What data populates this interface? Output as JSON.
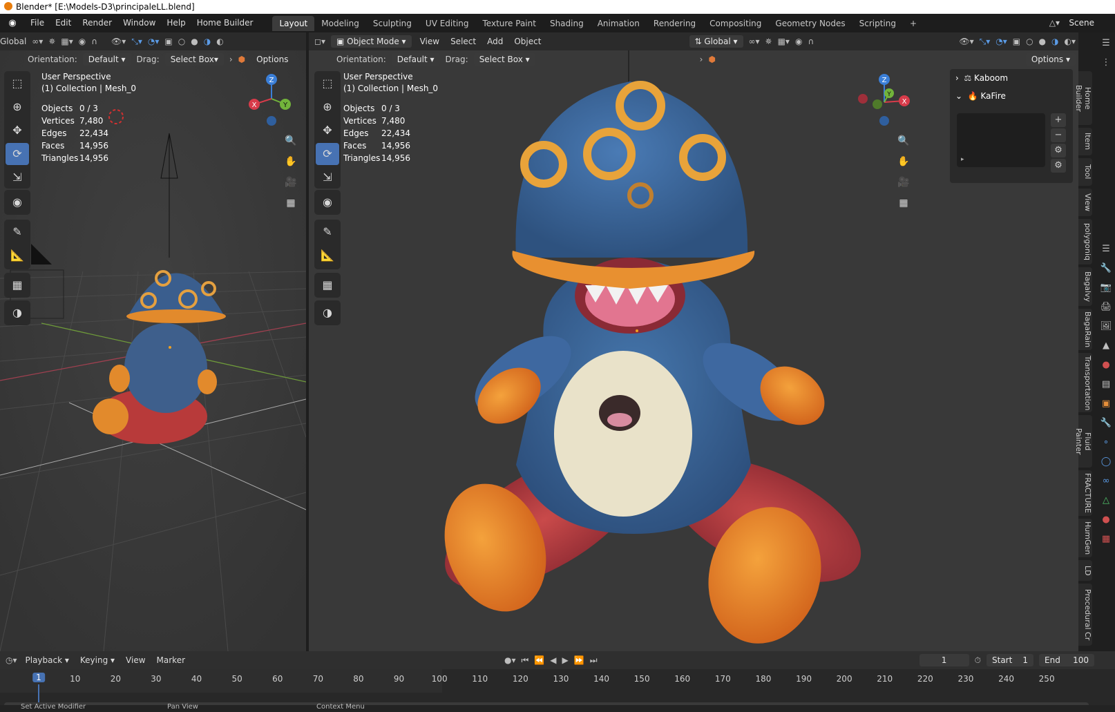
{
  "window": {
    "title": "Blender* [E:\\Models-D3\\principaleLL.blend]"
  },
  "menu": {
    "items": [
      "File",
      "Edit",
      "Render",
      "Window",
      "Help",
      "Home Builder"
    ]
  },
  "workspaces": [
    "Layout",
    "Modeling",
    "Sculpting",
    "UV Editing",
    "Texture Paint",
    "Shading",
    "Animation",
    "Rendering",
    "Compositing",
    "Geometry Nodes",
    "Scripting"
  ],
  "active_workspace": "Layout",
  "scene": {
    "label": "Scene"
  },
  "left_view": {
    "orientation_dd": "Global",
    "orientation_label": "Orientation:",
    "orientation_value": "Default",
    "drag_label": "Drag:",
    "drag_value": "Select Box",
    "options": "Options",
    "title": "User Perspective",
    "subtitle": "(1) Collection | Mesh_0",
    "stats": {
      "objects_k": "Objects",
      "objects_v": "0 / 3",
      "vertices_k": "Vertices",
      "vertices_v": "7,480",
      "edges_k": "Edges",
      "edges_v": "22,434",
      "faces_k": "Faces",
      "faces_v": "14,956",
      "triangles_k": "Triangles",
      "triangles_v": "14,956"
    }
  },
  "right_view": {
    "mode": "Object Mode",
    "menus": [
      "View",
      "Select",
      "Add",
      "Object"
    ],
    "transform": "Global",
    "orientation_label": "Orientation:",
    "orientation_value": "Default",
    "drag_label": "Drag:",
    "drag_value": "Select Box",
    "options": "Options",
    "title": "User Perspective",
    "subtitle": "(1) Collection | Mesh_0",
    "stats": {
      "objects_k": "Objects",
      "objects_v": "0 / 3",
      "vertices_k": "Vertices",
      "vertices_v": "7,480",
      "edges_k": "Edges",
      "edges_v": "22,434",
      "faces_k": "Faces",
      "faces_v": "14,956",
      "triangles_k": "Triangles",
      "triangles_v": "14,956"
    }
  },
  "npanel": {
    "item1": "Kaboom",
    "item2": "KaFire"
  },
  "sidebar_tabs": [
    "Home Builder",
    "Item",
    "Tool",
    "View",
    "polygoniq",
    "Bagalvy",
    "BagaRain",
    "Transportation",
    "Fluid Painter",
    "FRACTURE",
    "HumGen",
    "LD",
    "Procedural Cr"
  ],
  "gizmo": {
    "x": "X",
    "y": "Y",
    "z": "Z"
  },
  "timeline": {
    "menus": [
      "Playback",
      "Keying",
      "View",
      "Marker"
    ],
    "current_frame": "1",
    "start_label": "Start",
    "start_value": "1",
    "end_label": "End",
    "end_value": "100",
    "ticks": [
      "1",
      "10",
      "20",
      "30",
      "40",
      "50",
      "60",
      "70",
      "80",
      "90",
      "100",
      "110",
      "120",
      "130",
      "140",
      "150",
      "160",
      "170",
      "180",
      "190",
      "200",
      "210",
      "220",
      "230",
      "240",
      "250"
    ]
  },
  "statusbar": {
    "item1": "Set Active Modifier",
    "item2": "Pan View",
    "item3": "Context Menu"
  },
  "colors": {
    "accent": "#4772b3",
    "brand": "#e87d0d"
  }
}
